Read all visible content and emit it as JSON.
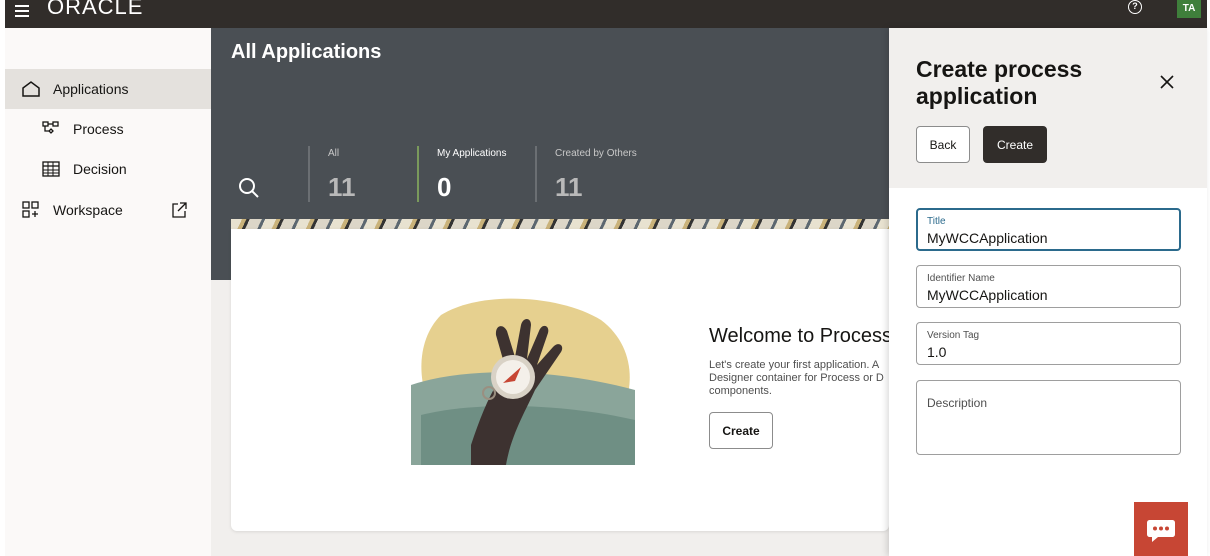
{
  "topbar": {
    "brand": "ORACLE",
    "avatar_initials": "TA",
    "help_icon": "help-circle-icon"
  },
  "sidebar": {
    "items": [
      {
        "label": "Applications",
        "icon": "home-icon",
        "active": true
      },
      {
        "label": "Process",
        "icon": "process-flow-icon"
      },
      {
        "label": "Decision",
        "icon": "table-grid-icon"
      },
      {
        "label": "Workspace",
        "icon": "workspace-grid-icon",
        "external": true
      }
    ]
  },
  "main": {
    "title": "All Applications",
    "tiles": [
      {
        "label": "All",
        "count": "11"
      },
      {
        "label": "My Applications",
        "count": "0",
        "selected": true
      },
      {
        "label": "Created by Others",
        "count": "11"
      }
    ]
  },
  "welcome": {
    "title": "Welcome to Process",
    "text": "Let's create your first application. A Designer container for Process or D components.",
    "create_label": "Create"
  },
  "drawer": {
    "title": "Create process application",
    "back_label": "Back",
    "create_label": "Create",
    "fields": {
      "title": {
        "label": "Title",
        "value": "MyWCCApplication"
      },
      "identifier": {
        "label": "Identifier Name",
        "value": "MyWCCApplication"
      },
      "version": {
        "label": "Version Tag",
        "value": "1.0"
      },
      "description": {
        "label": "Description",
        "value": ""
      }
    }
  },
  "colors": {
    "topbar": "#312d2a",
    "header": "#4a4f54",
    "focus": "#2b6a8c",
    "chat": "#c74634",
    "accent_tile": "#7a9a5c"
  }
}
